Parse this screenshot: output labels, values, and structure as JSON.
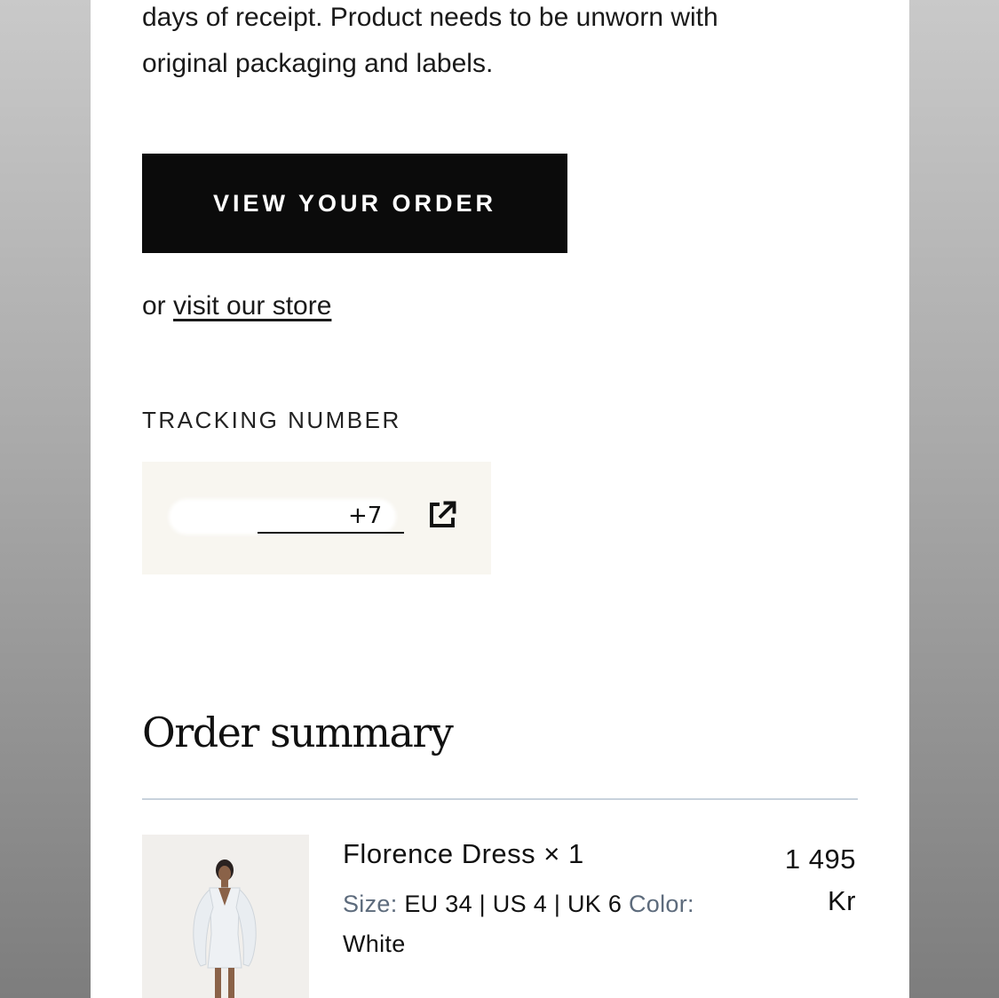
{
  "intro": {
    "line1": "days of receipt. Product needs to be unworn with",
    "line2": "original packaging and labels."
  },
  "cta": {
    "label": "VIEW YOUR ORDER"
  },
  "store": {
    "prefix": "or",
    "link_label": "visit our store"
  },
  "tracking": {
    "label": "TRACKING NUMBER",
    "visible_tail": "+7",
    "icon": "external-link-icon"
  },
  "order_summary": {
    "title": "Order summary",
    "items": [
      {
        "name": "Florence Dress × 1",
        "size_key": "Size:",
        "size_value": "EU 34 | US 4 | UK 6",
        "color_key": "Color:",
        "color_value": "White",
        "price_amount": "1 495",
        "price_currency": "Kr",
        "image": "dress-product-image"
      }
    ]
  },
  "colors": {
    "button_bg": "#0b0b0b",
    "tracking_box_bg": "#f8f6f0",
    "divider": "#c8d2dc",
    "meta_key": "#5d6b7c"
  }
}
